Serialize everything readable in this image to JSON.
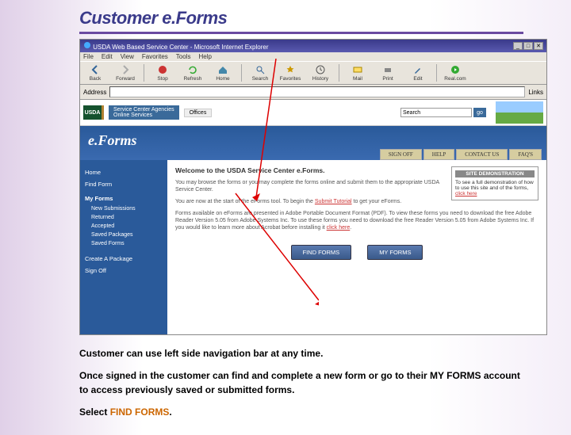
{
  "slide": {
    "title": "Customer e.Forms",
    "caption1": "Customer can use left side navigation bar at any time.",
    "caption2a": "Once signed in the customer can find and complete a new form or go to their MY FORMS account to access previously saved or submitted forms.",
    "caption3a": "Select ",
    "caption3b": "FIND FORMS",
    "caption3c": "."
  },
  "browser": {
    "title": "USDA Web Based Service Center - Microsoft Internet Explorer",
    "menu": [
      "File",
      "Edit",
      "View",
      "Favorites",
      "Tools",
      "Help"
    ],
    "toolbar": {
      "back": "Back",
      "forward": "Forward",
      "stop": "Stop",
      "refresh": "Refresh",
      "home": "Home",
      "search": "Search",
      "favorites": "Favorites",
      "history": "History",
      "mail": "Mail",
      "print": "Print",
      "edit": "Edit",
      "realcom": "Real.com"
    },
    "address_label": "Address",
    "links_label": "Links"
  },
  "usda": {
    "logo": "USDA",
    "sc": "Service Center Agencies\nOnline Services",
    "offices": "Offices",
    "search_label": "Search",
    "go": "go"
  },
  "banner": {
    "text": "e.Forms",
    "tabs": [
      "SIGN OFF",
      "HELP",
      "CONTACT US",
      "FAQ'S"
    ]
  },
  "sidebar": {
    "home": "Home",
    "find": "Find Form",
    "myforms": "My Forms",
    "subs": [
      "New Submissions",
      "Returned",
      "Accepted",
      "Saved Packages",
      "Saved Forms"
    ],
    "create": "Create A Package",
    "signoff": "Sign Off"
  },
  "main": {
    "welcome": "Welcome to the USDA Service Center e.Forms.",
    "p1": "You may browse the forms or you may complete the forms online and submit them to the appropriate USDA Service Center.",
    "p2a": "You are now at the start of the eForms tool. To begin the ",
    "p2link": "Submit Tutorial",
    "p2b": " to get your eForms.",
    "p3a": "Forms available on eForms are presented in Adobe Portable Document Format (PDF). To view these forms you need to download the free Adobe Reader Version 5.05 from Adobe Systems Inc. To use these forms you need to download the free Reader Version 5.05 from Adobe Systems Inc. If you would like to learn more about Acrobat before installing it ",
    "p3link": "click here",
    "demo_head": "SITE DEMONSTRATION",
    "demo_body": "To see a full demonstration of how to use this site and of the forms,",
    "demo_link": "click here",
    "btn_find": "FIND FORMS",
    "btn_my": "MY FORMS"
  }
}
